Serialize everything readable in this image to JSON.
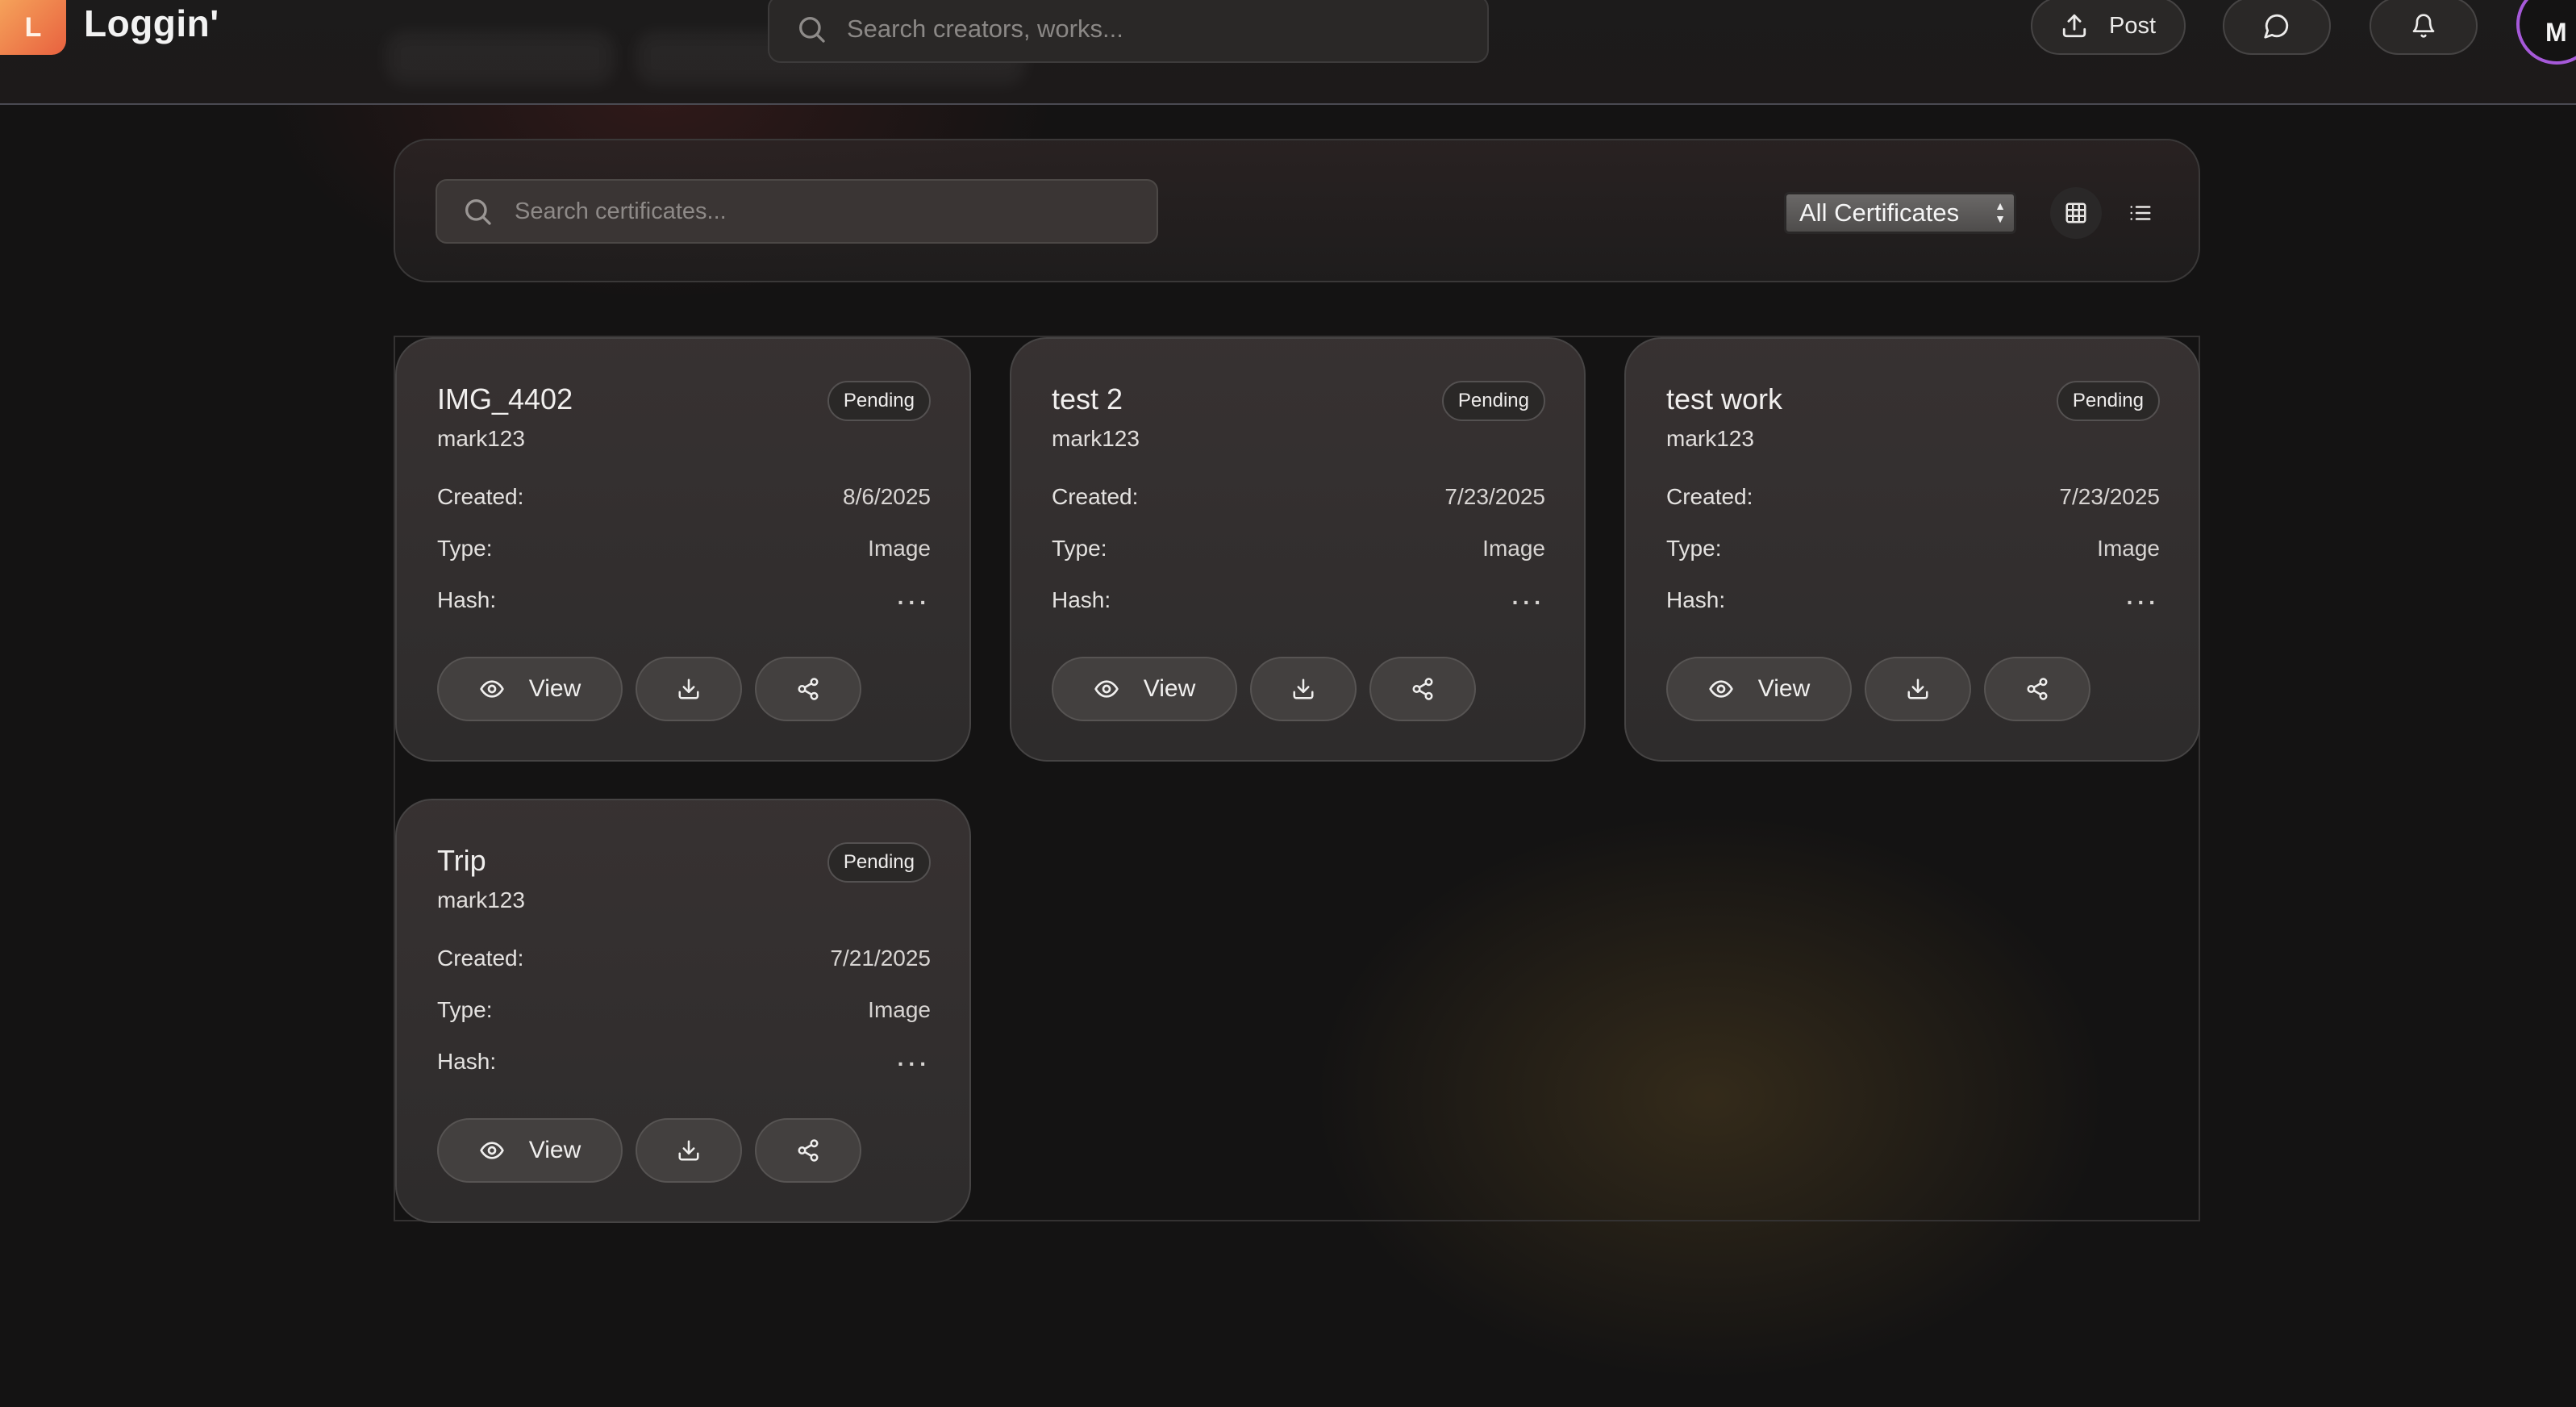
{
  "app": {
    "logo_letter": "L",
    "name": "Loggin'"
  },
  "header": {
    "search_placeholder": "Search creators, works...",
    "post_label": "Post",
    "avatar_initial": "M"
  },
  "filters": {
    "search_placeholder": "Search certificates...",
    "select_value": "All Certificates",
    "view_mode": "grid"
  },
  "labels": {
    "created": "Created:",
    "type": "Type:",
    "hash": "Hash:",
    "view": "View"
  },
  "certificates": [
    {
      "title": "IMG_4402",
      "owner": "mark123",
      "status": "Pending",
      "created": "8/6/2025",
      "type": "Image",
      "hash": "..."
    },
    {
      "title": "test 2",
      "owner": "mark123",
      "status": "Pending",
      "created": "7/23/2025",
      "type": "Image",
      "hash": "..."
    },
    {
      "title": "test work",
      "owner": "mark123",
      "status": "Pending",
      "created": "7/23/2025",
      "type": "Image",
      "hash": "..."
    },
    {
      "title": "Trip",
      "owner": "mark123",
      "status": "Pending",
      "created": "7/21/2025",
      "type": "Image",
      "hash": "..."
    }
  ]
}
